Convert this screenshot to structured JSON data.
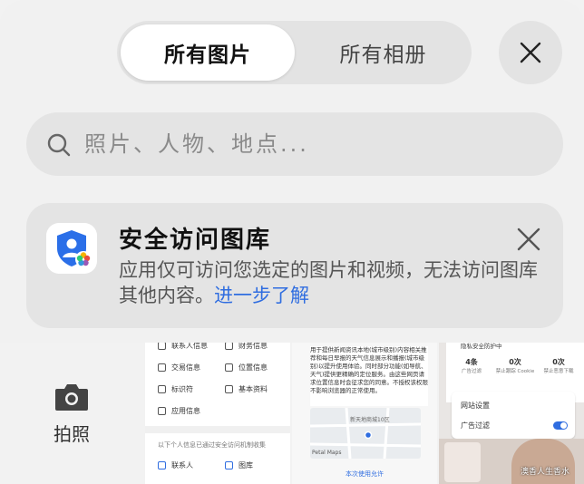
{
  "tabs": {
    "active": "所有图片",
    "inactive": "所有相册"
  },
  "search": {
    "placeholder": "照片、人物、地点..."
  },
  "notice": {
    "title": "安全访问图库",
    "description": "应用仅可访问您选定的图片和视频，无法访问图库其他内容。",
    "link": "进一步了解"
  },
  "camera": {
    "label": "拍照"
  },
  "thumb1": {
    "rows_left": [
      "联系人信息",
      "交易信息",
      "标识符",
      "应用信息"
    ],
    "rows_right": [
      "财务信息",
      "位置信息",
      "基本资料"
    ],
    "section": "以下个人信息已通过安全访问机制收集",
    "bottom_left": "联系人",
    "bottom_right": "图库"
  },
  "thumb2": {
    "text": "用于提供新闻资讯本地(城市级别)内容相关推荐和每日早报的天气信息展示和播报(城市级别)以提升使用体验。同时部分功能(如导航、天气)提供更精确的定位服务。由这些网页请求位置信息时会征求您的同意。不授权该权限不影响浏览器的正常使用。",
    "map_label": "新天地商城10区",
    "map_brand": "Petal Maps",
    "button": "本次使用允许"
  },
  "thumb3": {
    "header": "隐私安全防护中",
    "stats": [
      {
        "value": "4条",
        "label": "广告过滤"
      },
      {
        "value": "0次",
        "label": "禁止跟踪 Cookie"
      },
      {
        "value": "0次",
        "label": "禁止恶意下载"
      }
    ],
    "row1": "网站设置",
    "row2": "广告过滤",
    "caption": "澳香人生香水"
  },
  "colors": {
    "accent": "#2f6de0",
    "background": "#f1f1f1",
    "control": "#e3e3e3"
  }
}
